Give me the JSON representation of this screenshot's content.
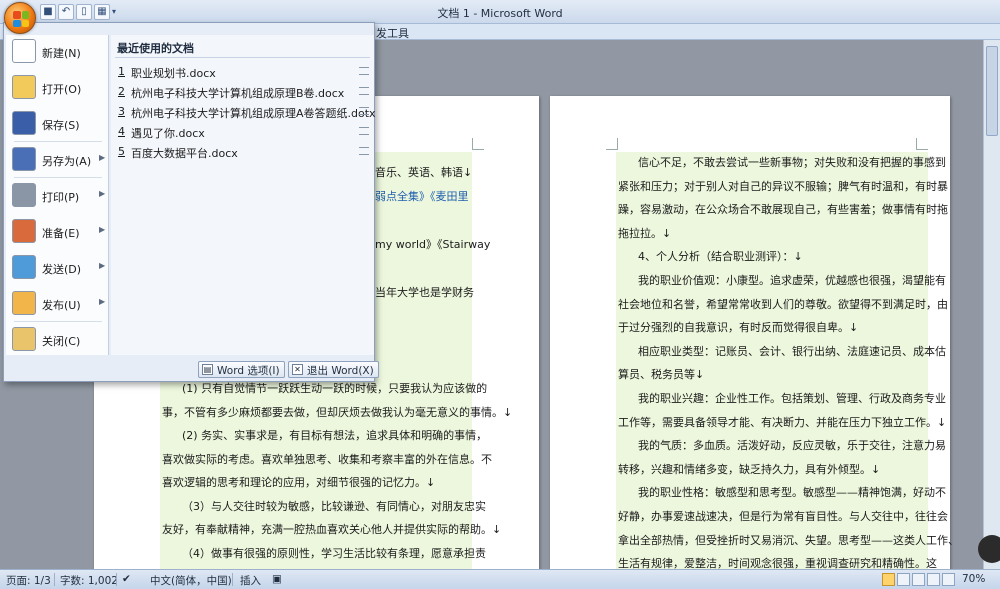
{
  "window": {
    "title": "文档 1 - Microsoft Word"
  },
  "quick_access": {
    "more_label": "▾"
  },
  "ribbon": {
    "partial_tab": "发工具"
  },
  "office_menu": {
    "items": [
      {
        "label": "新建(N)",
        "icon": "new-document-icon",
        "submenu": false
      },
      {
        "label": "打开(O)",
        "icon": "open-folder-icon",
        "submenu": false
      },
      {
        "label": "保存(S)",
        "icon": "save-icon",
        "submenu": false
      },
      {
        "label": "另存为(A)",
        "icon": "save-as-icon",
        "submenu": true
      },
      {
        "label": "打印(P)",
        "icon": "print-icon",
        "submenu": true
      },
      {
        "label": "准备(E)",
        "icon": "prepare-icon",
        "submenu": true
      },
      {
        "label": "发送(D)",
        "icon": "send-icon",
        "submenu": true
      },
      {
        "label": "发布(U)",
        "icon": "publish-icon",
        "submenu": true
      },
      {
        "label": "关闭(C)",
        "icon": "close-folder-icon",
        "submenu": false
      }
    ],
    "recent_title": "最近使用的文档",
    "recent": [
      {
        "num": "1",
        "name": "职业规划书.docx"
      },
      {
        "num": "2",
        "name": "杭州电子科技大学计算机组成原理B卷.docx"
      },
      {
        "num": "3",
        "name": "杭州电子科技大学计算机组成原理A卷答题纸.dotx"
      },
      {
        "num": "4",
        "name": "遇见了你.docx"
      },
      {
        "num": "5",
        "name": "百度大数据平台.docx"
      }
    ],
    "word_options": "Word 选项(I)",
    "exit_word": "退出 Word(X)"
  },
  "left_page": {
    "peek": [
      {
        "text": "音乐、英语、韩语↓"
      },
      {
        "text": "弱点全集》《麦田里",
        "link": true
      },
      {
        "text": "my world》《Stairway"
      },
      {
        "text": "当年大学也是学财务"
      }
    ],
    "lines": [
      "(1) 只有自觉情节一跃跃生动一跃的时候，只要我认为应该做的",
      "事，不管有多少麻烦都要去做，但却厌烦去做我认为毫无意义的事情。↓",
      "(2) 务实、实事求是，有目标有想法，追求具体和明确的事情，",
      "喜欢做实际的考虑。喜欢单独思考、收集和考察丰富的外在信息。不",
      "喜欢逻辑的思考和理论的应用，对细节很强的记忆力。↓",
      "（3）与人交往时较为敏感，比较谦逊、有同情心，对朋友忠实",
      "友好，有奉献精神，充满一腔热血喜欢关心他人并提供实际的帮助。↓",
      "（4）做事有很强的原则性，学习生活比较有条理，愿意承担责",
      "任，依据明晰的评估和收集的信息来做决定，充分发挥自己客观的判"
    ]
  },
  "right_page": {
    "lines": [
      "信心不足，不敢去尝试一些新事物；对失败和没有把握的事感到",
      "紧张和压力；对于别人对自己的异议不服输；脾气有时温和，有时暴",
      "躁，容易激动，在公众场合不敢展现自己，有些害羞；做事情有时拖",
      "拖拉拉。↓",
      "4、个人分析（结合职业测评）：↓",
      "我的职业价值观：小康型。追求虚荣，优越感也很强，渴望能有",
      "社会地位和名誉，希望常常收到人们的尊敬。欲望得不到满足时，由",
      "于过分强烈的自我意识，有时反而觉得很自卑。↓",
      "相应职业类型：记账员、会计、银行出纳、法庭速记员、成本估",
      "算员、税务员等↓",
      "我的职业兴趣：企业性工作。包括策划、管理、行政及商务专业",
      "工作等，需要具备领导才能、有决断力、并能在压力下独立工作。↓",
      "我的气质：多血质。活泼好动，反应灵敏，乐于交往，注意力易",
      "转移，兴趣和情绪多变，缺乏持久力，具有外倾型。↓",
      "我的职业性格：敏感型和思考型。敏感型——精神饱满，好动不",
      "好静，办事爱速战速决，但是行为常有盲目性。与人交往中，往往会",
      "拿出全部热情，但受挫折时又易消沉、失望。思考型——这类人工作、",
      "生活有规律，爱整洁，时间观念很强，重视调查研究和精确性。这",
      "类人优势思想僵化、教条、纠缠细节，缺乏灵活性。宜从事工程师、",
      "教师、财务和数据处理等职业。↓"
    ]
  },
  "status": {
    "page": "页面: 1/3",
    "words": "字数: 1,002",
    "language": "中文(简体，中国)",
    "mode": "插入",
    "zoom": "70%"
  },
  "watermark": {
    "text": "jingyan.baidu.com"
  }
}
